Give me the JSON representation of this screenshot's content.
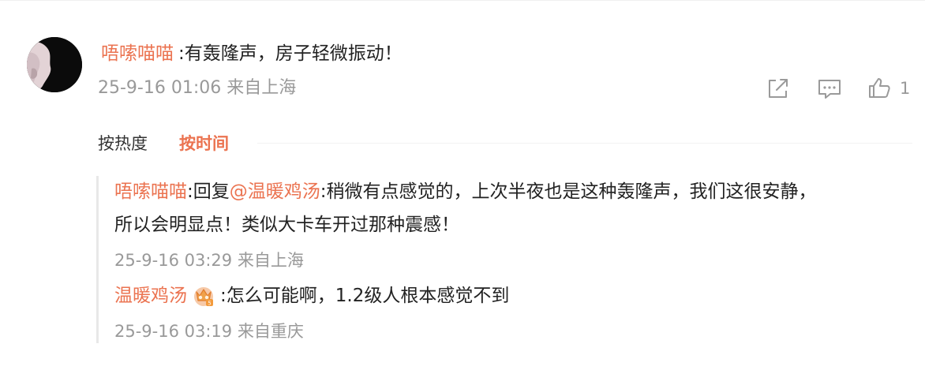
{
  "comment": {
    "username": "唔嗦喵喵",
    "text": ":有轰隆声，房子轻微振动！",
    "time": "25-9-16 01:06",
    "location": "来自上海",
    "meta": "25-9-16 01:06 来自上海",
    "like_count": "1",
    "avatar_icon": "avatar-image",
    "actions": [
      "share-icon",
      "comment-icon",
      "like-icon"
    ]
  },
  "sort": {
    "tabs": [
      {
        "label": "按热度",
        "active": false
      },
      {
        "label": "按时间",
        "active": true
      }
    ]
  },
  "replies": [
    {
      "username": "唔嗦喵喵",
      "reply_prefix": ":回复",
      "mention": "@温暖鸡汤",
      "text_line1": ":稍微有点感觉的，上次半夜也是这种轰隆声，我们这很安静，",
      "text_line2": "所以会明显点！类似大卡车开过那种震感！",
      "meta": "25-9-16 03:29 来自上海"
    },
    {
      "username": "温暖鸡汤",
      "badge_icon": "crown-badge-icon",
      "text": ":怎么可能啊，1.2级人根本感觉不到",
      "meta": "25-9-16 03:19 来自重庆"
    }
  ],
  "colors": {
    "accent": "#eb7350",
    "meta": "#999999",
    "text": "#222222"
  }
}
